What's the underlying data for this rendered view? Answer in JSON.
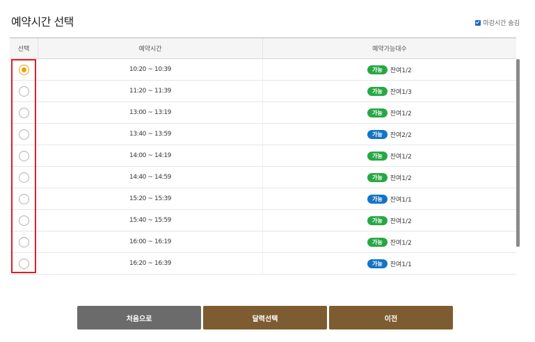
{
  "page": {
    "title": "예약시간 선택",
    "hide_closed_label": "마감시간 숨김",
    "hide_closed_checked": true
  },
  "table": {
    "headers": [
      "선택",
      "예약시간",
      "예약가능대수"
    ],
    "rows": [
      {
        "time": "10:20 ~ 10:39",
        "badge": "가능",
        "badge_color": "#28a745",
        "remain": "잔여1/2",
        "selected": true
      },
      {
        "time": "11:20 ~ 11:39",
        "badge": "가능",
        "badge_color": "#28a745",
        "remain": "잔여1/3",
        "selected": false
      },
      {
        "time": "13:00 ~ 13:19",
        "badge": "가능",
        "badge_color": "#28a745",
        "remain": "잔여1/2",
        "selected": false
      },
      {
        "time": "13:40 ~ 13:59",
        "badge": "가능",
        "badge_color": "#1474c4",
        "remain": "잔여2/2",
        "selected": false
      },
      {
        "time": "14:00 ~ 14:19",
        "badge": "가능",
        "badge_color": "#28a745",
        "remain": "잔여1/2",
        "selected": false
      },
      {
        "time": "14:40 ~ 14:59",
        "badge": "가능",
        "badge_color": "#28a745",
        "remain": "잔여1/2",
        "selected": false
      },
      {
        "time": "15:20 ~ 15:39",
        "badge": "가능",
        "badge_color": "#1474c4",
        "remain": "잔여1/1",
        "selected": false
      },
      {
        "time": "15:40 ~ 15:59",
        "badge": "가능",
        "badge_color": "#28a745",
        "remain": "잔여1/2",
        "selected": false
      },
      {
        "time": "16:00 ~ 16:19",
        "badge": "가능",
        "badge_color": "#28a745",
        "remain": "잔여1/2",
        "selected": false
      },
      {
        "time": "16:20 ~ 16:39",
        "badge": "가능",
        "badge_color": "#1474c4",
        "remain": "잔여1/1",
        "selected": false
      }
    ]
  },
  "buttons": {
    "first": "처음으로",
    "calendar": "달력선택",
    "prev": "이전"
  },
  "colors": {
    "accent_radio": "#f0a000",
    "highlight_box": "#e01b24",
    "button_gray": "#6b6b6b",
    "button_brown": "#7d5c31"
  }
}
